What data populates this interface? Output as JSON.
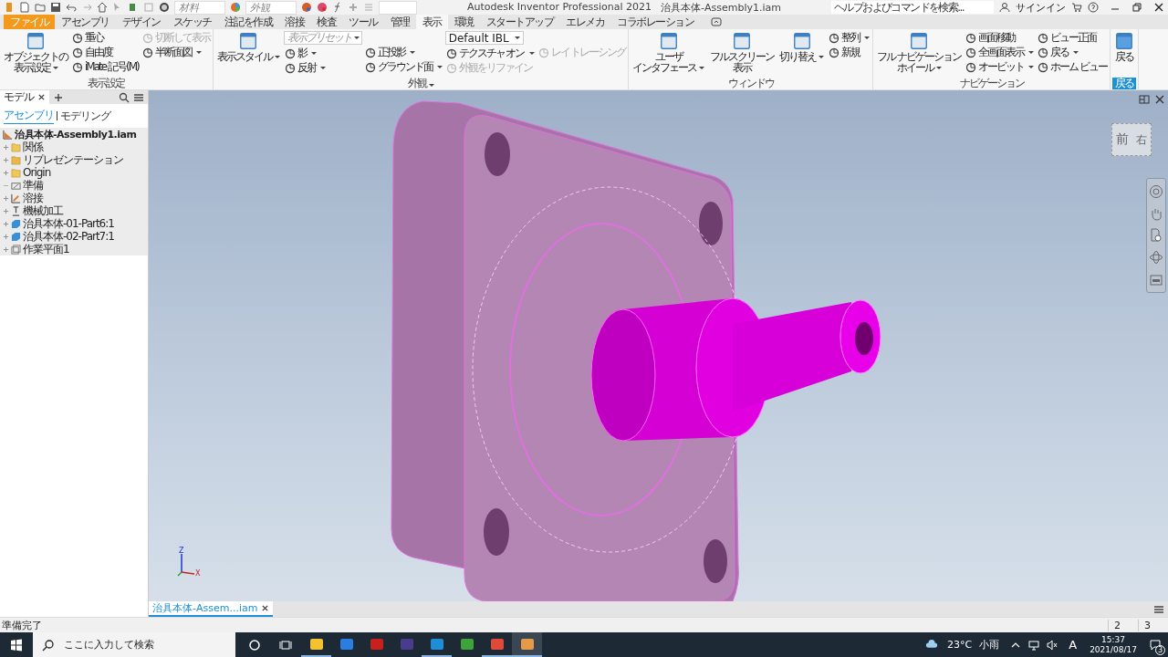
{
  "quick_access": {
    "material": "材料",
    "appearance": "外観"
  },
  "title_bar": {
    "app": "Autodesk Inventor Professional 2021",
    "document": "治具本体-Assembly1.iam",
    "search_placeholder": "ヘルプおよびコマンドを検索...",
    "sign_in": "サインイン"
  },
  "tabs": [
    {
      "label": "ファイル",
      "kind": "file",
      "selected": false
    },
    {
      "label": "アセンブリ",
      "kind": "tab",
      "selected": false
    },
    {
      "label": "デザイン",
      "kind": "tab",
      "selected": false
    },
    {
      "label": "スケッチ",
      "kind": "tab",
      "selected": false
    },
    {
      "label": "注記を作成",
      "kind": "tab",
      "selected": false
    },
    {
      "label": "溶接",
      "kind": "tab",
      "selected": false
    },
    {
      "label": "検査",
      "kind": "tab",
      "selected": false
    },
    {
      "label": "ツール",
      "kind": "tab",
      "selected": false
    },
    {
      "label": "管理",
      "kind": "tab",
      "selected": false
    },
    {
      "label": "表示",
      "kind": "tab",
      "selected": true
    },
    {
      "label": "環境",
      "kind": "tab",
      "selected": false
    },
    {
      "label": "スタートアップ",
      "kind": "tab",
      "selected": false
    },
    {
      "label": "エレメカ",
      "kind": "tab",
      "selected": false
    },
    {
      "label": "コラボレーション",
      "kind": "tab",
      "selected": false
    }
  ],
  "ribbon": {
    "panels": [
      {
        "title": "表示設定",
        "highlight": false,
        "menu": false,
        "columns": [
          {
            "items": [
              {
                "kind": "large",
                "lines": [
                  "オブジェクトの",
                  "表示設定"
                ],
                "menu": true,
                "disabled": false
              }
            ]
          },
          {
            "items": [
              {
                "kind": "small",
                "label": "重心",
                "menu": false,
                "disabled": false
              },
              {
                "kind": "small",
                "label": "自由度",
                "menu": false,
                "disabled": false
              },
              {
                "kind": "small",
                "label": "iMate 記号(M)",
                "menu": false,
                "disabled": false
              }
            ]
          },
          {
            "items": [
              {
                "kind": "small",
                "label": "切断して表示",
                "menu": false,
                "disabled": true
              },
              {
                "kind": "small",
                "label": "半断面図",
                "menu": true,
                "disabled": false
              }
            ]
          }
        ]
      },
      {
        "title": "外観",
        "highlight": false,
        "menu": true,
        "columns": [
          {
            "items": [
              {
                "kind": "large",
                "lines": [
                  "表示スタイル"
                ],
                "menu": true,
                "disabled": false
              }
            ]
          },
          {
            "items": [
              {
                "kind": "select",
                "placeholder": "表示プリセット",
                "disabled": false
              },
              {
                "kind": "small",
                "label": "影",
                "menu": true,
                "disabled": false
              },
              {
                "kind": "small",
                "label": "反射",
                "menu": true,
                "disabled": false
              }
            ]
          },
          {
            "items": [
              {
                "kind": "small",
                "label": "正投影",
                "menu": true,
                "disabled": false
              },
              {
                "kind": "small",
                "label": "グラウンド面",
                "menu": true,
                "disabled": false
              }
            ]
          },
          {
            "items": [
              {
                "kind": "select",
                "value": "Default IBL",
                "disabled": false
              },
              {
                "kind": "small",
                "label": "テクスチャ オン",
                "menu": true,
                "disabled": false
              },
              {
                "kind": "small",
                "label": "外観をリファイン",
                "menu": false,
                "disabled": true
              }
            ]
          },
          {
            "items": [
              {
                "kind": "small",
                "label": "レイ トレーシング",
                "menu": false,
                "disabled": true
              }
            ]
          }
        ]
      },
      {
        "title": "ウィンドウ",
        "highlight": false,
        "menu": false,
        "columns": [
          {
            "items": [
              {
                "kind": "large",
                "lines": [
                  "ユーザ",
                  "インタフェース"
                ],
                "menu": true,
                "disabled": false
              }
            ]
          },
          {
            "items": [
              {
                "kind": "large",
                "lines": [
                  "フルスクリーン",
                  "表示"
                ],
                "menu": false,
                "disabled": false
              }
            ]
          },
          {
            "items": [
              {
                "kind": "large",
                "lines": [
                  "切り替え"
                ],
                "menu": true,
                "disabled": false
              }
            ]
          },
          {
            "items": [
              {
                "kind": "small",
                "label": "整列",
                "menu": true,
                "disabled": false
              },
              {
                "kind": "small",
                "label": "新規",
                "menu": false,
                "disabled": false
              }
            ]
          }
        ]
      },
      {
        "title": "ナビゲーション",
        "highlight": false,
        "menu": false,
        "columns": [
          {
            "items": [
              {
                "kind": "large",
                "lines": [
                  "フル ナビゲーション",
                  "ホイール"
                ],
                "menu": true,
                "disabled": false
              }
            ]
          },
          {
            "items": [
              {
                "kind": "small",
                "label": "画面移動",
                "menu": false,
                "disabled": false
              },
              {
                "kind": "small",
                "label": "全画面表示",
                "menu": true,
                "disabled": false
              },
              {
                "kind": "small",
                "label": "オービット",
                "menu": true,
                "disabled": false
              }
            ]
          },
          {
            "items": [
              {
                "kind": "small",
                "label": "ビュー正面",
                "menu": false,
                "disabled": false
              },
              {
                "kind": "small",
                "label": "戻る",
                "menu": true,
                "disabled": false
              },
              {
                "kind": "small",
                "label": "ホーム ビュー",
                "menu": false,
                "disabled": false
              }
            ]
          }
        ]
      },
      {
        "title": "戻る",
        "highlight": true,
        "menu": false,
        "columns": [
          {
            "items": [
              {
                "kind": "large",
                "lines": [
                  "戻る"
                ],
                "menu": false,
                "disabled": false
              }
            ]
          }
        ]
      }
    ]
  },
  "browser": {
    "tab": "モデル",
    "modes": [
      {
        "label": "アセンブリ",
        "selected": true
      },
      {
        "label": "モデリング",
        "selected": false
      }
    ],
    "root": "治具本体-Assembly1.iam",
    "children": [
      {
        "label": "関係",
        "kind": "folder",
        "has_children": true
      },
      {
        "label": "リプレゼンテーション",
        "kind": "representation",
        "has_children": true
      },
      {
        "label": "Origin",
        "kind": "folder",
        "has_children": true
      },
      {
        "label": "準備",
        "kind": "sketch",
        "has_children": false
      },
      {
        "label": "溶接",
        "kind": "weld",
        "has_children": true
      },
      {
        "label": "機械加工",
        "kind": "machining",
        "has_children": true
      },
      {
        "label": "治具本体-01-Part6:1",
        "kind": "part",
        "has_children": true
      },
      {
        "label": "治具本体-02-Part7:1",
        "kind": "part",
        "has_children": true
      },
      {
        "label": "作業平面1",
        "kind": "plane",
        "has_children": true
      }
    ]
  },
  "viewport": {
    "view_cube": {
      "front": "前",
      "right": "右"
    },
    "axes": {
      "z": "Z",
      "x": "X"
    }
  },
  "document_tabs": [
    {
      "label": "治具本体-Assem...iam",
      "selected": true
    }
  ],
  "status_bar": {
    "message": "準備完了",
    "cells": [
      "2",
      "3"
    ]
  },
  "taskbar": {
    "search_placeholder": "ここに入力して検索",
    "apps": [
      {
        "kind": "explorer",
        "running": true,
        "selected": false
      },
      {
        "kind": "store",
        "running": false,
        "selected": false
      },
      {
        "kind": "pdf",
        "running": false,
        "selected": false
      },
      {
        "kind": "star",
        "running": false,
        "selected": false
      },
      {
        "kind": "quill",
        "running": true,
        "selected": false
      },
      {
        "kind": "ftp",
        "running": false,
        "selected": false
      },
      {
        "kind": "browser",
        "running": true,
        "selected": false
      },
      {
        "kind": "inventor",
        "running": true,
        "selected": true
      }
    ],
    "temperature": "23°C",
    "weather": "小雨",
    "ime": "A",
    "time": "15:37",
    "date": "2021/08/17",
    "notifications": "3"
  }
}
